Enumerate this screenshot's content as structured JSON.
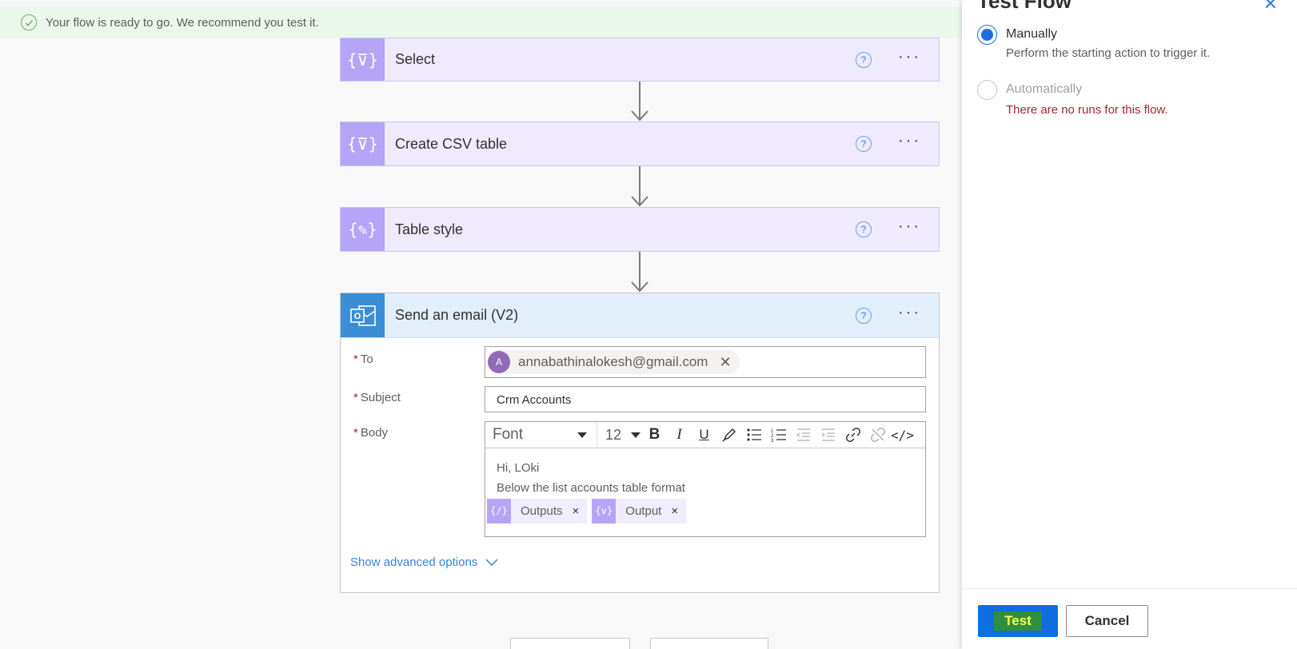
{
  "banner": {
    "message": "Your flow is ready to go. We recommend you test it."
  },
  "steps": [
    {
      "title": "Select",
      "icon": "braces-filter-icon"
    },
    {
      "title": "Create CSV table",
      "icon": "braces-filter-icon"
    },
    {
      "title": "Table style",
      "icon": "braces-pencil-icon"
    }
  ],
  "email_step": {
    "title": "Send an email (V2)",
    "icon": "outlook-icon",
    "to_label": "To",
    "to_avatar": "A",
    "to_value": "annabathinalokesh@gmail.com",
    "subject_label": "Subject",
    "subject_value": "Crm Accounts",
    "body_label": "Body",
    "font_value": "Font",
    "size_value": "12",
    "body_line1": "Hi, LOki",
    "body_line2": "Below the list accounts table format",
    "tokens": [
      {
        "label": "Outputs",
        "icon": "{∕}"
      },
      {
        "label": "Output",
        "icon": "{v}"
      }
    ],
    "show_advanced": "Show advanced options"
  },
  "panel": {
    "title": "Test Flow",
    "option_manual": "Manually",
    "option_manual_desc": "Perform the starting action to trigger it.",
    "option_auto": "Automatically",
    "option_auto_error": "There are no runs for this flow.",
    "test_label": "Test",
    "cancel_label": "Cancel"
  },
  "colors": {
    "accent": "#0f6fe0",
    "action_purple": "#b6a4f7",
    "outlook_blue": "#3b8ed6",
    "error": "#a4262c"
  }
}
